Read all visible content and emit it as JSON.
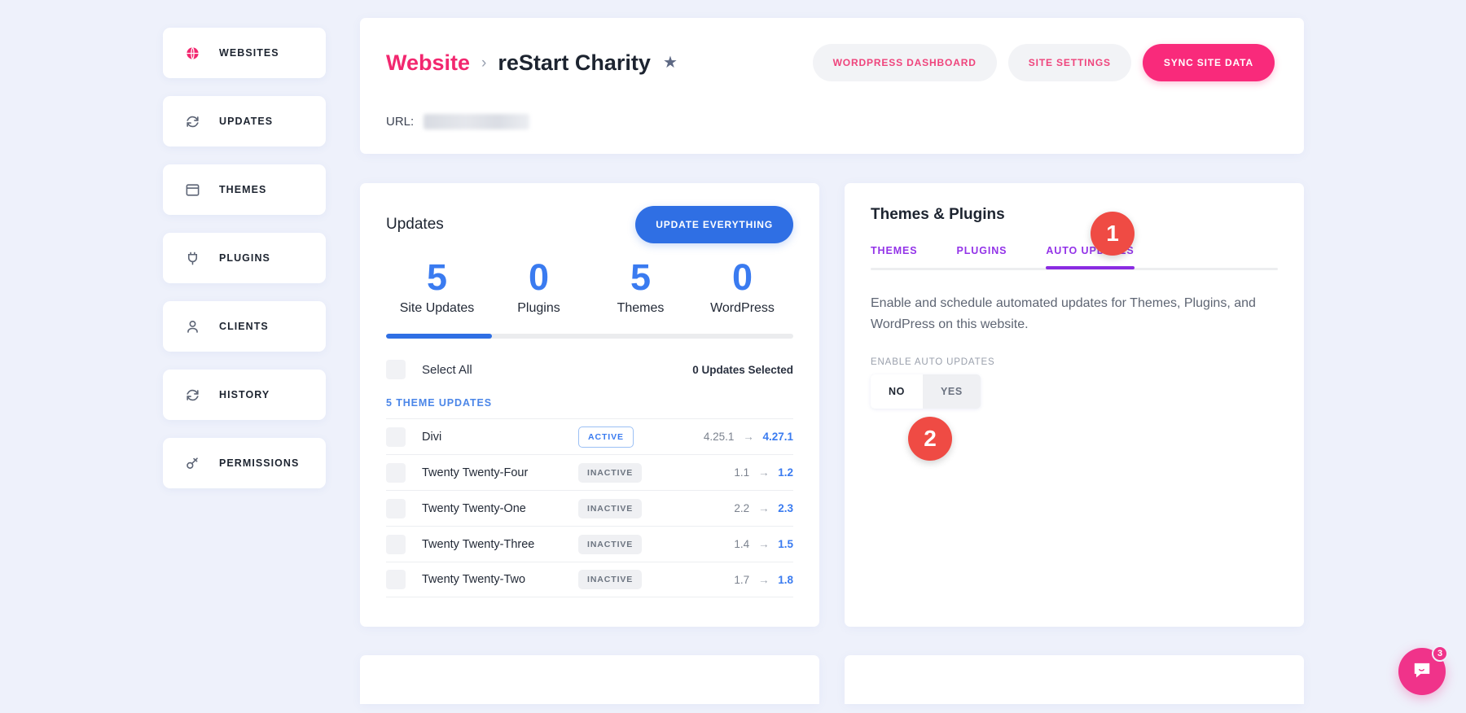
{
  "sidebar": {
    "items": [
      {
        "label": "WEBSITES",
        "icon": "globe-icon",
        "active": true
      },
      {
        "label": "UPDATES",
        "icon": "refresh-icon",
        "active": false
      },
      {
        "label": "THEMES",
        "icon": "window-icon",
        "active": false
      },
      {
        "label": "PLUGINS",
        "icon": "plug-icon",
        "active": false
      },
      {
        "label": "CLIENTS",
        "icon": "user-icon",
        "active": false
      },
      {
        "label": "HISTORY",
        "icon": "refresh-icon",
        "active": false
      },
      {
        "label": "PERMISSIONS",
        "icon": "key-icon",
        "active": false
      }
    ]
  },
  "header": {
    "breadcrumb_root": "Website",
    "breadcrumb_sep": "›",
    "site_name": "reStart Charity",
    "favorite_icon": "star-icon",
    "url_label": "URL:",
    "url_value": "",
    "actions": {
      "wordpress_dashboard": "WORDPRESS DASHBOARD",
      "site_settings": "SITE SETTINGS",
      "sync_site_data": "SYNC SITE DATA"
    }
  },
  "updates": {
    "title": "Updates",
    "update_everything": "UPDATE EVERYTHING",
    "stats": [
      {
        "value": "5",
        "label": "Site Updates"
      },
      {
        "value": "0",
        "label": "Plugins"
      },
      {
        "value": "5",
        "label": "Themes"
      },
      {
        "value": "0",
        "label": "WordPress"
      }
    ],
    "progress_percent": 26,
    "select_all": "Select All",
    "selected_count": "0 Updates Selected",
    "section_header": "5 THEME UPDATES",
    "rows": [
      {
        "name": "Divi",
        "status": "ACTIVE",
        "status_kind": "active",
        "version_from": "4.25.1",
        "version_to": "4.27.1"
      },
      {
        "name": "Twenty Twenty-Four",
        "status": "INACTIVE",
        "status_kind": "inactive",
        "version_from": "1.1",
        "version_to": "1.2"
      },
      {
        "name": "Twenty Twenty-One",
        "status": "INACTIVE",
        "status_kind": "inactive",
        "version_from": "2.2",
        "version_to": "2.3"
      },
      {
        "name": "Twenty Twenty-Three",
        "status": "INACTIVE",
        "status_kind": "inactive",
        "version_from": "1.4",
        "version_to": "1.5"
      },
      {
        "name": "Twenty Twenty-Two",
        "status": "INACTIVE",
        "status_kind": "inactive",
        "version_from": "1.7",
        "version_to": "1.8"
      }
    ],
    "arrow_glyph": "→"
  },
  "themes_plugins": {
    "title": "Themes & Plugins",
    "tabs": [
      {
        "label": "THEMES",
        "active": false
      },
      {
        "label": "PLUGINS",
        "active": false
      },
      {
        "label": "AUTO UPDATES",
        "active": true
      }
    ],
    "description": "Enable and schedule automated updates for Themes, Plugins, and WordPress on this website.",
    "enable_label": "ENABLE AUTO UPDATES",
    "toggle": {
      "no": "NO",
      "yes": "YES",
      "selected": "NO"
    }
  },
  "callouts": [
    {
      "number": "1"
    },
    {
      "number": "2"
    }
  ],
  "chat": {
    "icon": "chat-bubble-icon",
    "unread_count": "3"
  },
  "colors": {
    "accent_pink": "#f92a7b",
    "accent_blue": "#2f6fe4",
    "accent_purple": "#8a2be2",
    "callout_red": "#ef4b44",
    "page_bg": "#eef1fb"
  }
}
